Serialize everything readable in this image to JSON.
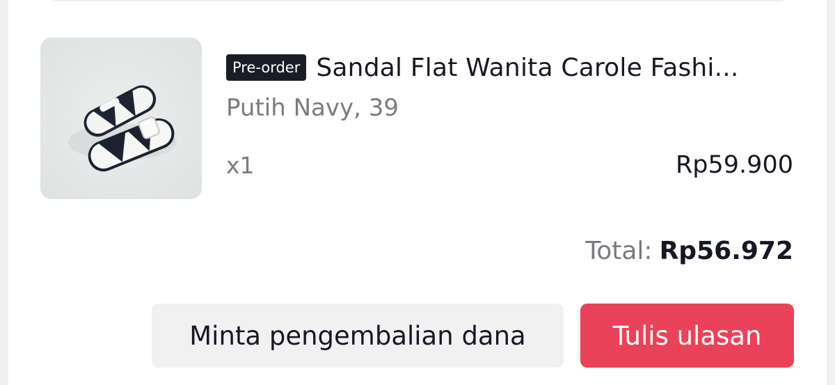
{
  "order_item": {
    "badge": "Pre-order",
    "title": "Sandal Flat Wanita Carole Fashi...",
    "variant": "Putih Navy, 39",
    "quantity": "x1",
    "price": "Rp59.900"
  },
  "summary": {
    "total_label": "Total:",
    "total_value": "Rp56.972"
  },
  "actions": {
    "refund_label": "Minta pengembalian dana",
    "review_label": "Tulis ulasan"
  },
  "colors": {
    "page_background": "#f1f1f2",
    "badge_background": "#1a1d26",
    "primary_button": "#ea4259",
    "secondary_button": "#f1f1f2",
    "muted_text": "#7a7b80",
    "main_text": "#161823"
  },
  "icons": {
    "product_image": "sandal-product-photo"
  }
}
